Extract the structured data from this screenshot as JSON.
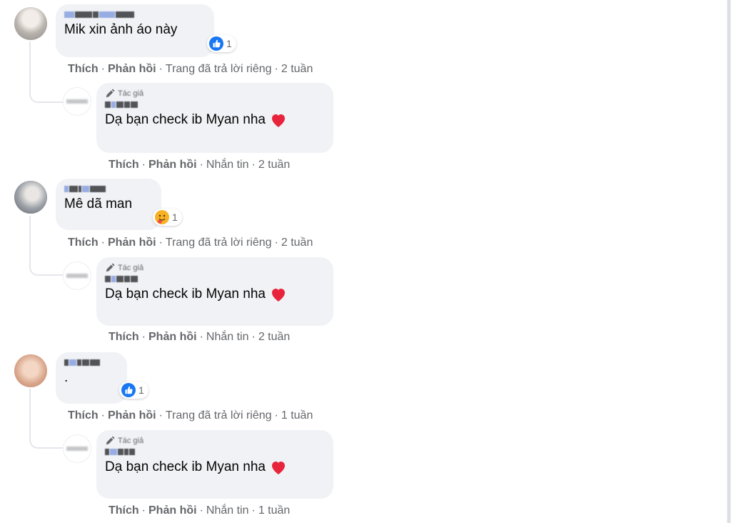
{
  "comments": [
    {
      "text": "Mik xin ảnh áo này",
      "reaction_type": "like",
      "reaction_count": "1",
      "actions": {
        "like": "Thích",
        "reply": "Phản hồi",
        "status": "Trang đã trả lời riêng",
        "time": "2 tuần"
      },
      "reply": {
        "author_badge": "Tác giả",
        "text": "Dạ bạn check ib Myan nha",
        "actions": {
          "like": "Thích",
          "reply": "Phản hồi",
          "status": "Nhắn tin",
          "time": "2 tuần"
        }
      }
    },
    {
      "text": "Mê dã man",
      "reaction_type": "care",
      "reaction_count": "1",
      "actions": {
        "like": "Thích",
        "reply": "Phản hồi",
        "status": "Trang đã trả lời riêng",
        "time": "2 tuần"
      },
      "reply": {
        "author_badge": "Tác giả",
        "text": "Dạ bạn check ib Myan nha",
        "actions": {
          "like": "Thích",
          "reply": "Phản hồi",
          "status": "Nhắn tin",
          "time": "2 tuần"
        }
      }
    },
    {
      "text": ".",
      "reaction_type": "like",
      "reaction_count": "1",
      "actions": {
        "like": "Thích",
        "reply": "Phản hồi",
        "status": "Trang đã trả lời riêng",
        "time": "1 tuần"
      },
      "reply": {
        "author_badge": "Tác giả",
        "text": "Dạ bạn check ib Myan nha",
        "actions": {
          "like": "Thích",
          "reply": "Phản hồi",
          "status": "Nhắn tin",
          "time": "1 tuần"
        }
      }
    }
  ],
  "colors": {
    "like_blue": "#1877f2",
    "heart_red": "#f33e58",
    "bubble_bg": "#f0f2f5",
    "meta_gray": "#65676b"
  },
  "icons": {
    "like": "thumbs-up-icon",
    "care": "care-emoji-icon",
    "heart": "red-heart-icon",
    "author": "pencil-author-icon"
  }
}
